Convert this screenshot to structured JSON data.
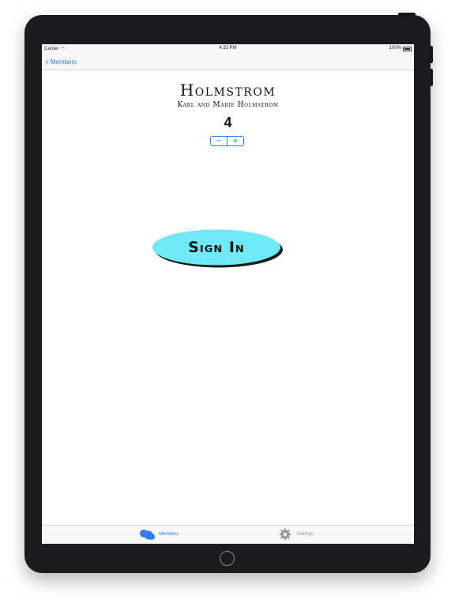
{
  "status_bar": {
    "carrier": "Carrier",
    "time": "4:32 PM",
    "battery": "100%"
  },
  "nav": {
    "back_label": "Members"
  },
  "family": {
    "name": "Holmstrom",
    "members": "Karl and Marie Holmstrom",
    "count": "4"
  },
  "stepper": {
    "minus": "−",
    "plus": "+"
  },
  "signin": {
    "label": "Sign In"
  },
  "tabs": [
    {
      "label": "Members",
      "icon": "members-icon",
      "selected": true
    },
    {
      "label": "Settings",
      "icon": "gear-icon",
      "selected": false
    }
  ],
  "colors": {
    "accent": "#2f7cf6",
    "signin_fill": "#6ee9f5",
    "bezel": "#1c1c1e"
  }
}
